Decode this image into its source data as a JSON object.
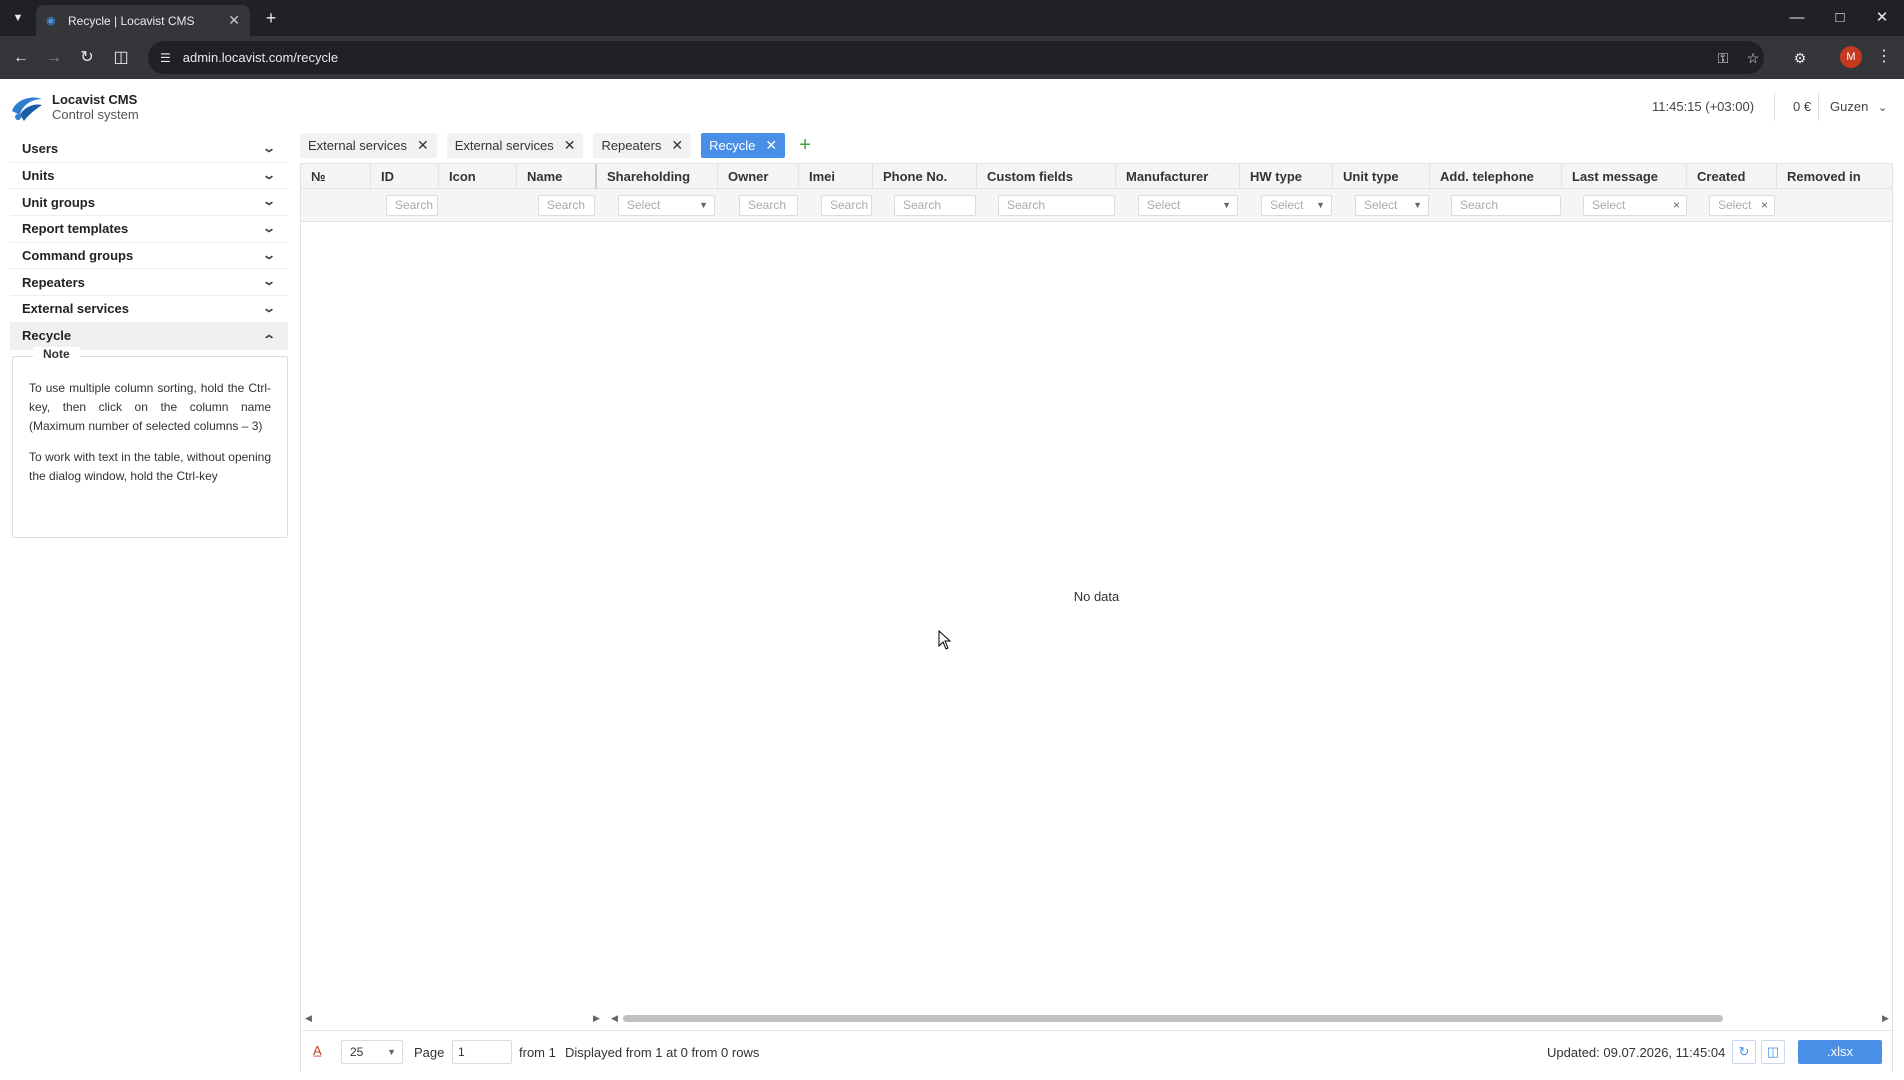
{
  "browser": {
    "tab_title": "Recycle | Locavist CMS",
    "url": "admin.locavist.com/recycle",
    "profile_initial": "M"
  },
  "app": {
    "name": "Locavist CMS",
    "subtitle": "Control system",
    "clock": "11:45:15 (+03:00)",
    "balance": "0 €",
    "user": "Guzen"
  },
  "sidebar": {
    "items": [
      {
        "label": "Users",
        "expanded": false
      },
      {
        "label": "Units",
        "expanded": false
      },
      {
        "label": "Unit groups",
        "expanded": false
      },
      {
        "label": "Report templates",
        "expanded": false
      },
      {
        "label": "Command groups",
        "expanded": false
      },
      {
        "label": "Repeaters",
        "expanded": false
      },
      {
        "label": "External services",
        "expanded": false
      },
      {
        "label": "Recycle",
        "expanded": true
      }
    ],
    "note": {
      "title": "Note",
      "p1": "To use multiple column sorting, hold the Ctrl-key, then click on the column name (Maximum number of selected columns – 3)",
      "p2": "To work with text in the table, without opening the dialog window, hold the Ctrl-key"
    }
  },
  "tabs": [
    {
      "label": "External services",
      "active": false
    },
    {
      "label": "External services",
      "active": false
    },
    {
      "label": "Repeaters",
      "active": false
    },
    {
      "label": "Recycle",
      "active": true
    }
  ],
  "add_tab": "+",
  "grid": {
    "columns": [
      "№",
      "ID",
      "Icon",
      "Name",
      "Shareholding",
      "Owner",
      "Imei",
      "Phone No.",
      "Custom fields",
      "Manufacturer",
      "HW type",
      "Unit type",
      "Add. telephone",
      "Last message",
      "Created",
      "Removed in"
    ],
    "filters": {
      "id": "Search",
      "name": "Search",
      "shareholding": "Select",
      "owner": "Search",
      "imei": "Search",
      "phone": "Search",
      "custom_fields": "Search",
      "manufacturer": "Select",
      "hw_type": "Select",
      "unit_type": "Select",
      "add_telephone": "Search",
      "last_message": "Select",
      "created": "Select"
    },
    "empty_text": "No data"
  },
  "footer": {
    "page_size": "25",
    "page_label": "Page",
    "page_value": "1",
    "from_text": "from 1",
    "displayed": "Displayed from 1 at 0 from 0 rows",
    "updated": "Updated: 09.07.2026, 11:45:04",
    "export": ".xlsx"
  },
  "colors": {
    "accent": "#4a8fe7",
    "add_green": "#35a835",
    "chrome_dark": "#202124"
  }
}
